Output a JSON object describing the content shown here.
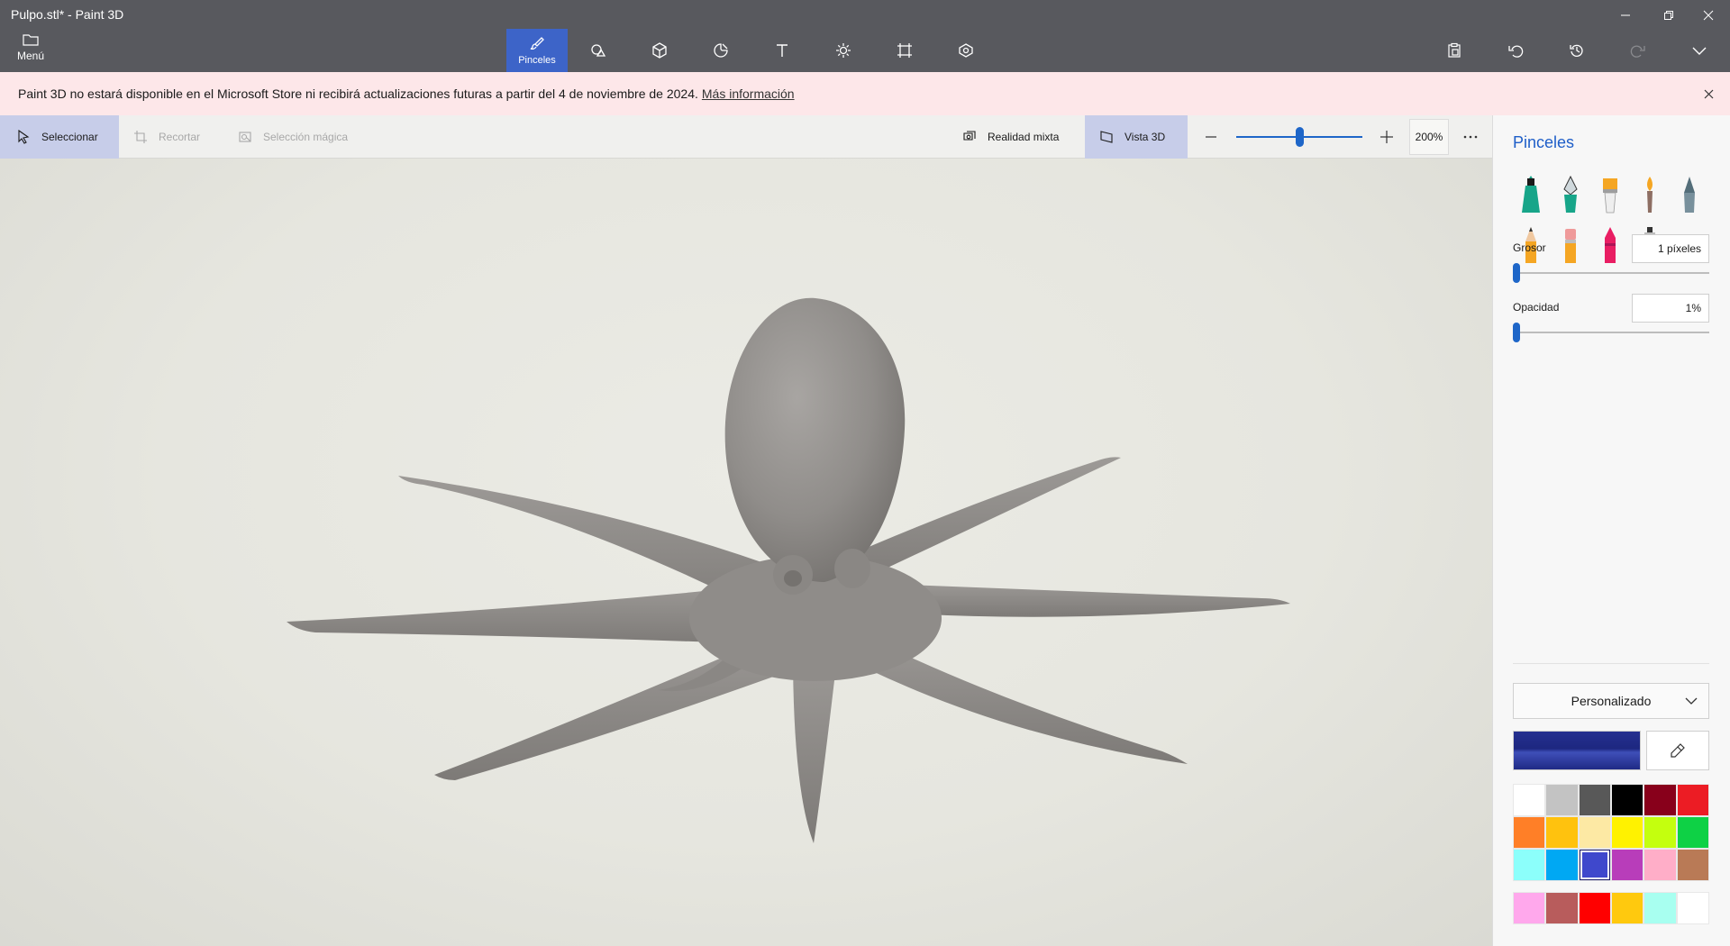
{
  "window": {
    "title": "Pulpo.stl* - Paint 3D",
    "minimize_icon": "minimize-icon",
    "restore_icon": "restore-icon",
    "close_icon": "close-icon"
  },
  "topbar": {
    "menu_label": "Menú",
    "tools": [
      {
        "name": "pinceles",
        "label": "Pinceles",
        "icon": "brush-icon",
        "active": true
      },
      {
        "name": "2d-shapes",
        "label": "",
        "icon": "shapes-2d-icon",
        "active": false
      },
      {
        "name": "3d-shapes",
        "label": "",
        "icon": "cube-icon",
        "active": false
      },
      {
        "name": "stickers",
        "label": "",
        "icon": "sticker-icon",
        "active": false
      },
      {
        "name": "text",
        "label": "",
        "icon": "text-icon",
        "active": false
      },
      {
        "name": "effects",
        "label": "",
        "icon": "sun-icon",
        "active": false
      },
      {
        "name": "canvas",
        "label": "",
        "icon": "crop-canvas-icon",
        "active": false
      },
      {
        "name": "3d-library",
        "label": "",
        "icon": "library-3d-icon",
        "active": false
      }
    ],
    "right_tools": [
      "paste-icon",
      "undo-icon",
      "history-icon",
      "redo-icon",
      "expand-icon"
    ]
  },
  "notice": {
    "text": "Paint 3D no estará disponible en el Microsoft Store ni recibirá actualizaciones futuras a partir del 4 de noviembre de 2024.",
    "link_text": "Más información"
  },
  "subbar": {
    "select_label": "Seleccionar",
    "crop_label": "Recortar",
    "magic_select_label": "Selección mágica",
    "mixed_reality_label": "Realidad mixta",
    "view3d_label": "Vista 3D",
    "zoom_level": "200%",
    "zoom_fraction": 0.5
  },
  "panel": {
    "title": "Pinceles",
    "brushes": [
      "marker-icon",
      "calligraphy-pen-icon",
      "oil-brush-icon",
      "watercolor-icon",
      "pixel-pen-icon",
      "pencil-icon",
      "eraser-icon",
      "crayon-icon",
      "spray-can-icon",
      "fill-bucket-icon"
    ],
    "thickness_label": "Grosor",
    "thickness_value": "1 píxeles",
    "opacity_label": "Opacidad",
    "opacity_value": "1%",
    "palette_name": "Personalizado",
    "current_color": "#1f2a85",
    "swatches": [
      "#ffffff",
      "#c3c3c3",
      "#585858",
      "#000000",
      "#88001b",
      "#ec1c24",
      "#ff7f27",
      "#ffc20e",
      "#fde9a4",
      "#fff200",
      "#c4ff0e",
      "#0ed145",
      "#8cfffb",
      "#00a8f3",
      "#3f48cc",
      "#b83dba",
      "#ffaec8",
      "#b97a56"
    ],
    "selected_swatch_index": 14,
    "custom_swatches": [
      "#ffa8ec",
      "#b85c5c",
      "#ff0000",
      "#ffc90e",
      "#a8fff0",
      "#ffffff"
    ]
  },
  "canvas": {
    "model_name": "octopus-3d-model"
  }
}
